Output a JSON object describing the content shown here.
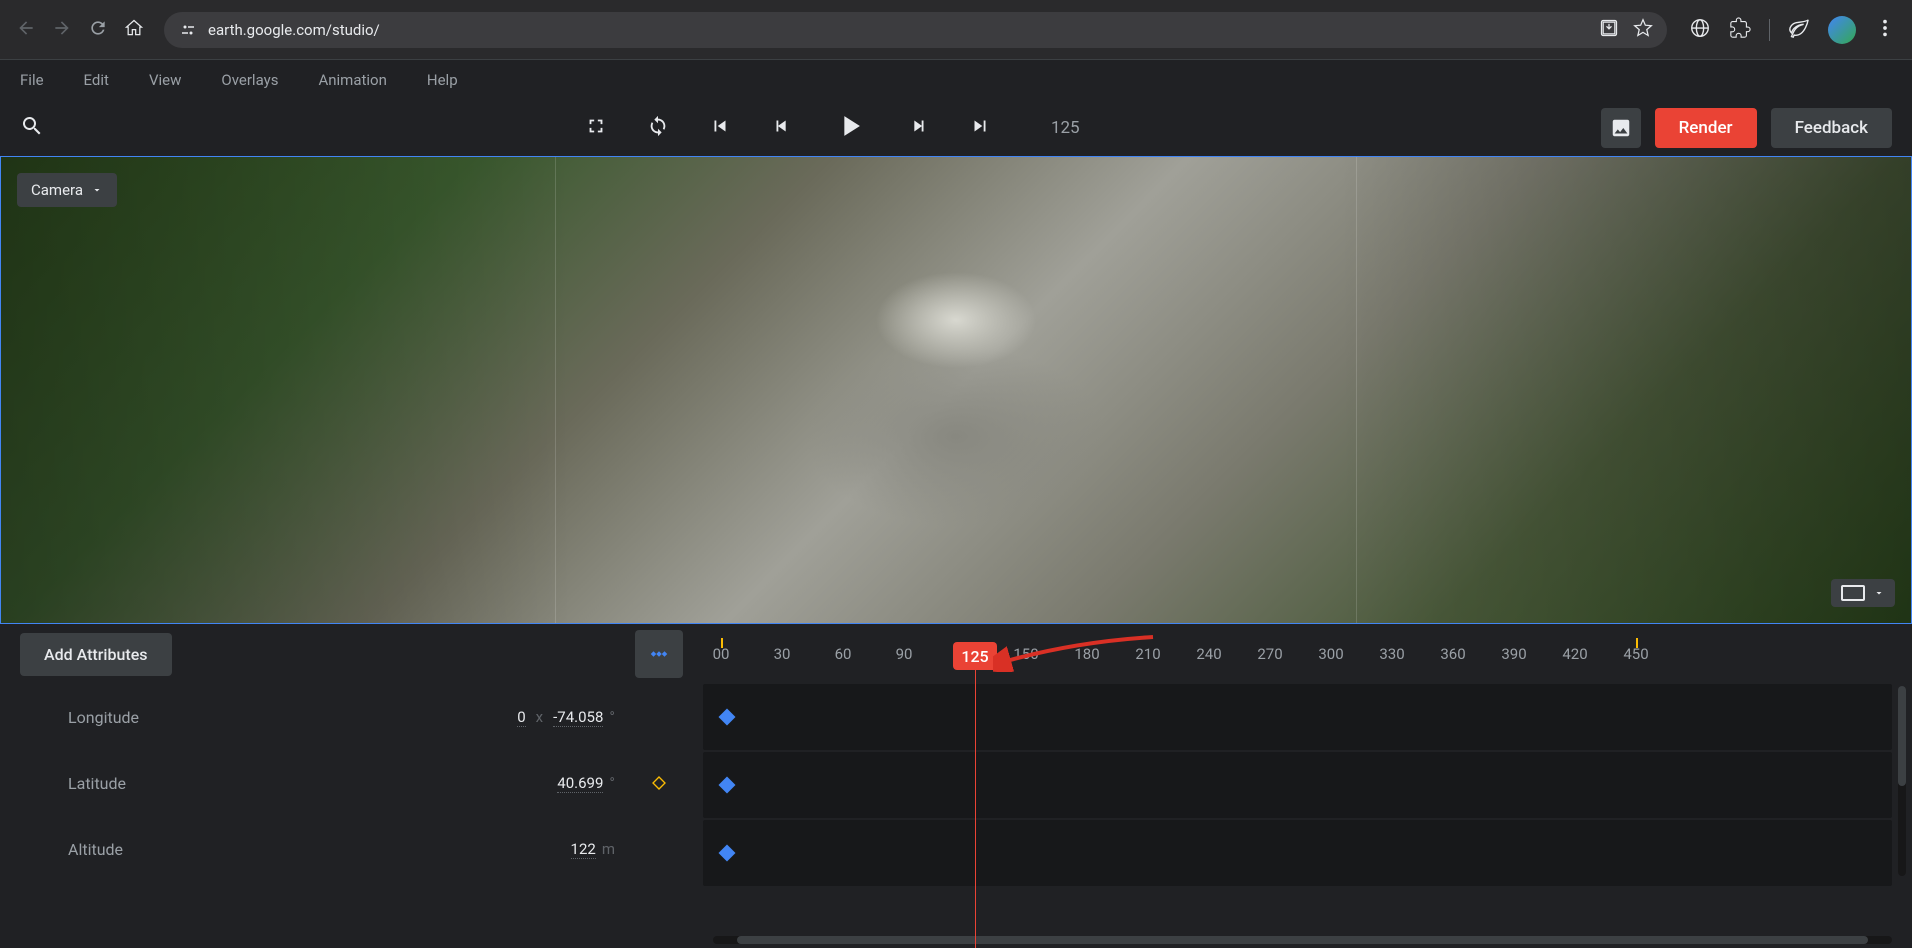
{
  "browser": {
    "url": "earth.google.com/studio/"
  },
  "menu": [
    "File",
    "Edit",
    "View",
    "Overlays",
    "Animation",
    "Help"
  ],
  "toolbar": {
    "frame_counter": "125",
    "render_label": "Render",
    "feedback_label": "Feedback"
  },
  "viewport": {
    "camera_label": "Camera"
  },
  "timeline": {
    "add_attributes_label": "Add Attributes",
    "playhead_frame": "125",
    "ruler_ticks": [
      "00",
      "30",
      "60",
      "90",
      "",
      "150",
      "180",
      "210",
      "240",
      "270",
      "300",
      "330",
      "360",
      "390",
      "420",
      "450"
    ],
    "attributes": [
      {
        "label": "Longitude",
        "secondary": "0",
        "value": "-74.058",
        "unit": "°",
        "keyframe_active": false
      },
      {
        "label": "Latitude",
        "secondary": "",
        "value": "40.699",
        "unit": "°",
        "keyframe_active": true
      },
      {
        "label": "Altitude",
        "secondary": "",
        "value": "122",
        "unit": "m",
        "keyframe_active": false
      }
    ]
  }
}
